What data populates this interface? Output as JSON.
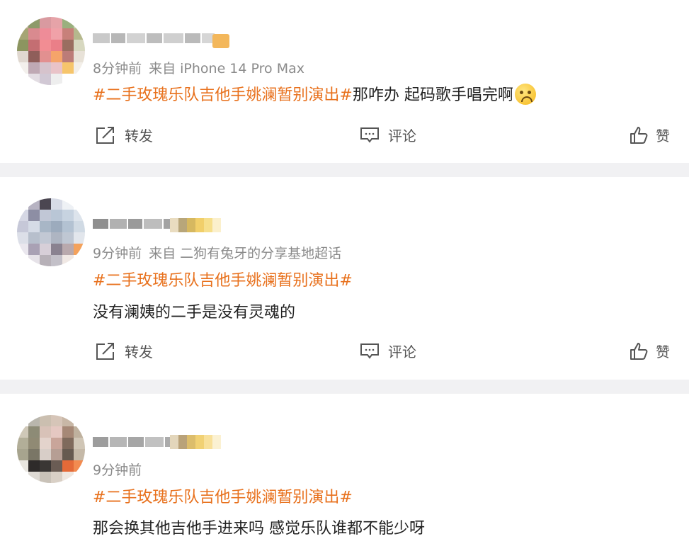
{
  "posts": [
    {
      "meta_time": "8分钟前",
      "meta_source": "来自 iPhone 14 Pro Max",
      "topic": "#二手玫瑰乐队吉他手姚澜暂别演出#",
      "text": "那咋办 起码歌手唱完啊",
      "emoji": "crying-face"
    },
    {
      "meta_time": "9分钟前",
      "meta_source": "来自 二狗有兔牙的分享基地超话",
      "topic": "#二手玫瑰乐队吉他手姚澜暂别演出#",
      "text": "没有澜姨的二手是没有灵魂的"
    },
    {
      "meta_time": "9分钟前",
      "meta_source": "",
      "topic": "#二手玫瑰乐队吉他手姚澜暂别演出#",
      "text": "那会换其他吉他手进来吗 感觉乐队谁都不能少呀"
    }
  ],
  "actions": {
    "repost": "转发",
    "comment": "评论",
    "like": "赞"
  },
  "colors": {
    "topic": "#e8711d",
    "separator": "#f1f1f3",
    "meta": "#8a8a8a"
  }
}
